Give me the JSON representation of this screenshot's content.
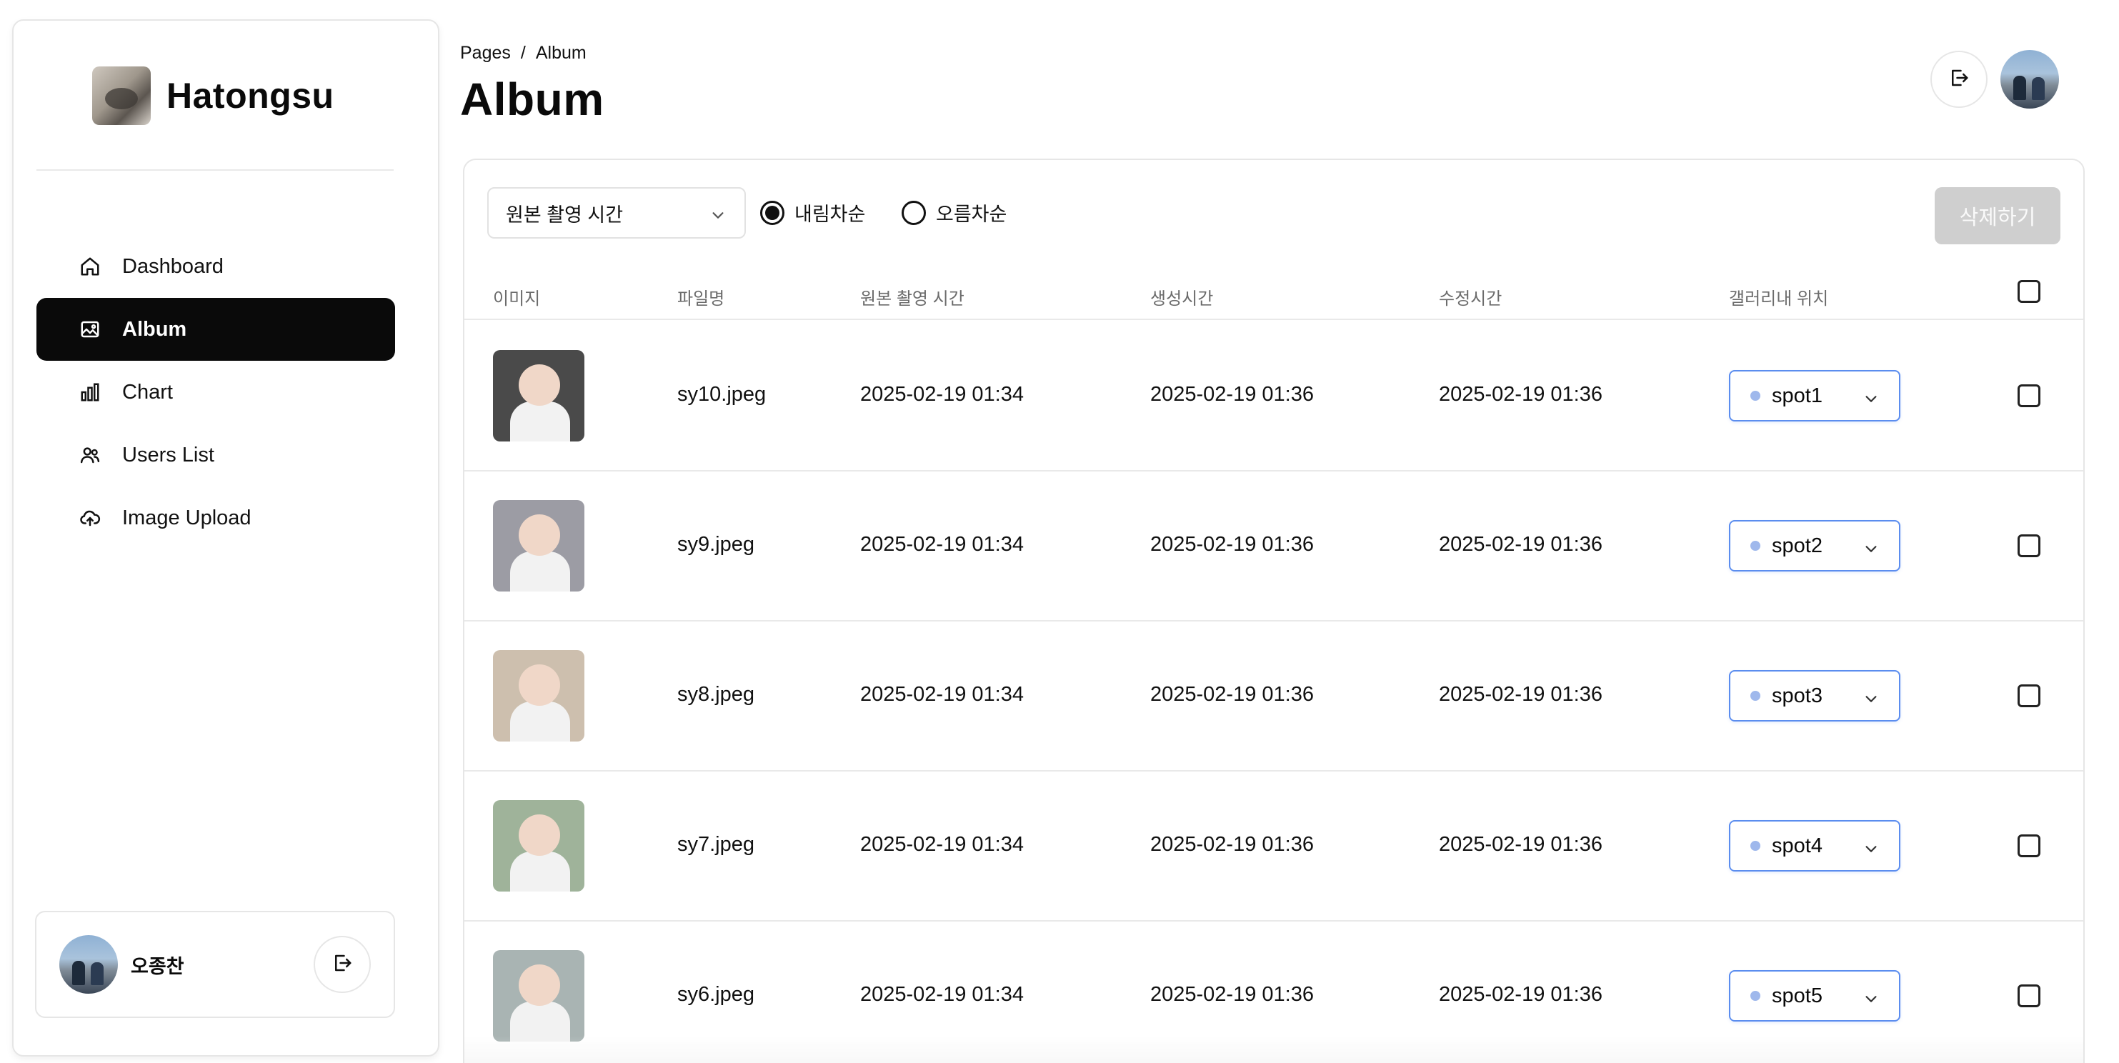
{
  "sidebar": {
    "brand_name": "Hatongsu",
    "items": [
      {
        "label": "Dashboard",
        "icon": "home-icon",
        "active": false
      },
      {
        "label": "Album",
        "icon": "image-icon",
        "active": true
      },
      {
        "label": "Chart",
        "icon": "bar-chart-icon",
        "active": false
      },
      {
        "label": "Users List",
        "icon": "users-icon",
        "active": false
      },
      {
        "label": "Image Upload",
        "icon": "cloud-upload-icon",
        "active": false
      }
    ],
    "profile": {
      "name": "오종찬",
      "action_icon": "logout-icon"
    }
  },
  "header": {
    "breadcrumb": [
      "Pages",
      "/",
      "Album"
    ],
    "title": "Album",
    "actions": {
      "logout_icon": "logout-icon",
      "avatar": "user-avatar"
    }
  },
  "toolbar": {
    "sort_field": "원본 촬영 시간",
    "radio_desc": "내림차순",
    "radio_asc": "오름차순",
    "selected_order": "desc",
    "delete_label": "삭제하기"
  },
  "table": {
    "headers": [
      "이미지",
      "파일명",
      "원본 촬영 시간",
      "생성시간",
      "수정시간",
      "갤러리내 위치"
    ],
    "rows": [
      {
        "file": "sy10.jpeg",
        "taken": "2025-02-19 01:34",
        "created": "2025-02-19 01:36",
        "modified": "2025-02-19 01:36",
        "spot": "spot1",
        "thumb_bg": "#4a4a4a"
      },
      {
        "file": "sy9.jpeg",
        "taken": "2025-02-19 01:34",
        "created": "2025-02-19 01:36",
        "modified": "2025-02-19 01:36",
        "spot": "spot2",
        "thumb_bg": "#9c9ca4"
      },
      {
        "file": "sy8.jpeg",
        "taken": "2025-02-19 01:34",
        "created": "2025-02-19 01:36",
        "modified": "2025-02-19 01:36",
        "spot": "spot3",
        "thumb_bg": "#cdbfae"
      },
      {
        "file": "sy7.jpeg",
        "taken": "2025-02-19 01:34",
        "created": "2025-02-19 01:36",
        "modified": "2025-02-19 01:36",
        "spot": "spot4",
        "thumb_bg": "#9fb39a"
      },
      {
        "file": "sy6.jpeg",
        "taken": "2025-02-19 01:34",
        "created": "2025-02-19 01:36",
        "modified": "2025-02-19 01:36",
        "spot": "spot5",
        "thumb_bg": "#a9b4b3"
      }
    ]
  },
  "colors": {
    "accent": "#5b8def",
    "active_nav": "#0a0a0a",
    "disabled_button": "#cfcfcf"
  }
}
